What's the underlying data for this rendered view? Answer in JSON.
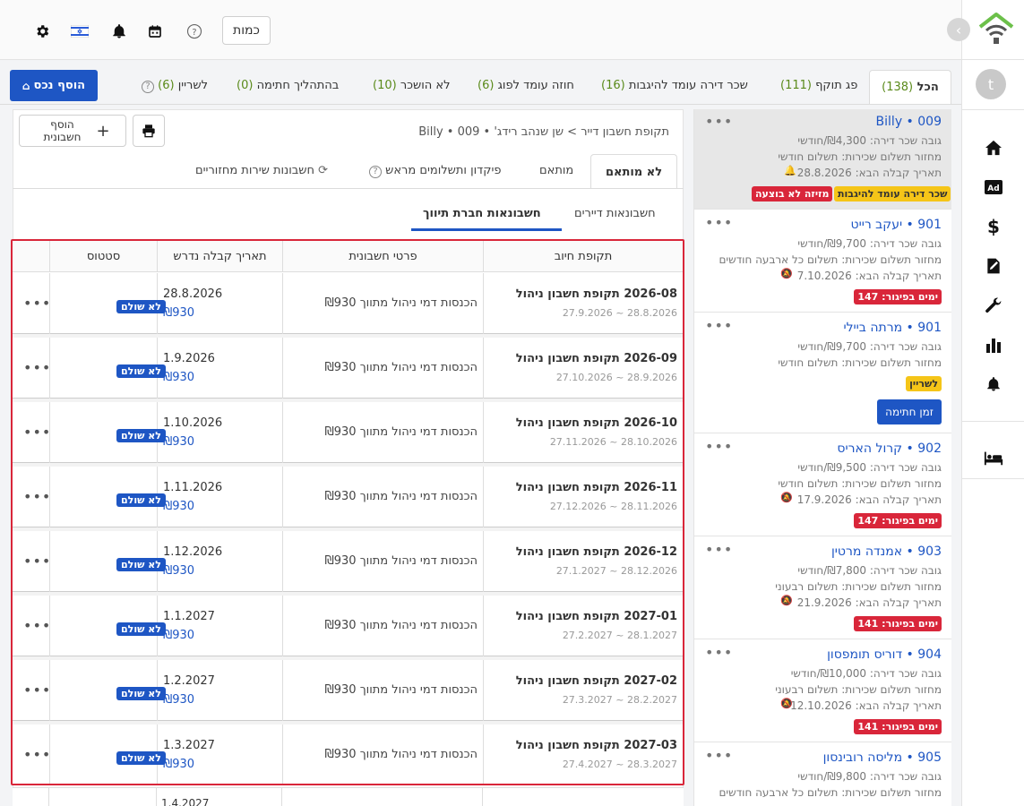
{
  "topbar": {
    "currency_label": "כמות",
    "icons": [
      "gear-icon",
      "flag-israel-icon",
      "bell-icon",
      "calendar-icon",
      "help-icon"
    ]
  },
  "sidebar": {
    "avatar_letter": "t",
    "nav": [
      "home-icon",
      "ad-icon",
      "dollar-icon",
      "contract-edit-icon",
      "wrench-icon",
      "bar-chart-icon",
      "bell-icon",
      "bed-icon"
    ]
  },
  "tabs": {
    "add_property": "הוסף נכס",
    "items": [
      {
        "label": "הכל",
        "count": "(138)"
      },
      {
        "label": "פג תוקף",
        "count": "(111)"
      },
      {
        "label": "שכר דירה עומד להיגבות",
        "count": "(16)"
      },
      {
        "label": "חוזה עומד לפוג",
        "count": "(6)"
      },
      {
        "label": "לא הושכר",
        "count": "(10)"
      },
      {
        "label": "בהתהליך חתימה",
        "count": "(0)"
      },
      {
        "label": "לשריין",
        "count": "(6)"
      }
    ]
  },
  "units": [
    {
      "title": "Billy • 009",
      "rent": "גובה שכר דירה: ₪4,300/חודשי",
      "cycle": "מחזור תשלום שכירות: תשלום חודשי",
      "next": "תאריך קבלה הבא: 28.8.2026",
      "badges": [
        "מזיזה לא בוצעה",
        "שכר דירה עומד להיגבות"
      ]
    },
    {
      "title": "901 • יעקב רייט",
      "rent": "גובה שכר דירה: ₪9,700/חודשי",
      "cycle": "מחזור תשלום שכירות: תשלום כל ארבעה חודשים",
      "next": "תאריך קבלה הבא: 7.10.2026",
      "badges": [
        "ימים בפיגור: 147"
      ]
    },
    {
      "title": "901 • מרתה ביילי",
      "rent": "גובה שכר דירה: ₪9,700/חודשי",
      "cycle": "מחזור תשלום שכירות: תשלום חודשי",
      "next": "",
      "badges": [
        "לשריין"
      ],
      "button": "זמן חתימה"
    },
    {
      "title": "902 • קרול האריס",
      "rent": "גובה שכר דירה: ₪9,500/חודשי",
      "cycle": "מחזור תשלום שכירות: תשלום חודשי",
      "next": "תאריך קבלה הבא: 17.9.2026",
      "badges": [
        "ימים בפיגור: 147"
      ]
    },
    {
      "title": "903 • אמנדה מרטין",
      "rent": "גובה שכר דירה: ₪7,800/חודשי",
      "cycle": "מחזור תשלום שכירות: תשלום רבעוני",
      "next": "תאריך קבלה הבא: 21.9.2026",
      "badges": [
        "ימים בפיגור: 141"
      ]
    },
    {
      "title": "904 • דוריס תומפסון",
      "rent": "גובה שכר דירה: ₪10,000/חודשי",
      "cycle": "מחזור תשלום שכירות: תשלום רבעוני",
      "next": "תאריך קבלה הבא: 12.10.2026",
      "badges": [
        "ימים בפיגור: 141"
      ]
    },
    {
      "title": "905 • מליסה רובינסון",
      "rent": "גובה שכר דירה: ₪9,800/חודשי",
      "cycle": "מחזור תשלום שכירות: תשלום כל ארבעה חודשים",
      "next": "",
      "badges": []
    }
  ],
  "main": {
    "add_invoice": "הוסף חשבונית",
    "breadcrumb": "תקופת חשבון דייר > שן שנהב רידג' • 009 • Billy",
    "subtabs": [
      "לא מותאם",
      "מותאם",
      "פיקדון ותשלומים מראש",
      "חשבונות שירות מחזוריים"
    ],
    "typetabs": [
      "חשבונאות דיירים",
      "חשבונאות חברת תיווך"
    ],
    "columns": {
      "period": "תקופת חיוב",
      "details": "פרטי חשבונית",
      "date": "תאריך קבלה נדרש",
      "status": "סטטוס"
    },
    "rows": [
      {
        "title": "2026-08 תקופת חשבון ניהול",
        "range": "28.8.2026 ~ 27.9.2026",
        "details": "הכנסות דמי ניהול מתווך ₪930",
        "date": "28.8.2026",
        "amount": "₪930",
        "status": "לא שולם"
      },
      {
        "title": "2026-09 תקופת חשבון ניהול",
        "range": "28.9.2026 ~ 27.10.2026",
        "details": "הכנסות דמי ניהול מתווך ₪930",
        "date": "1.9.2026",
        "amount": "₪930",
        "status": "לא שולם"
      },
      {
        "title": "2026-10 תקופת חשבון ניהול",
        "range": "28.10.2026 ~ 27.11.2026",
        "details": "הכנסות דמי ניהול מתווך ₪930",
        "date": "1.10.2026",
        "amount": "₪930",
        "status": "לא שולם"
      },
      {
        "title": "2026-11 תקופת חשבון ניהול",
        "range": "28.11.2026 ~ 27.12.2026",
        "details": "הכנסות דמי ניהול מתווך ₪930",
        "date": "1.11.2026",
        "amount": "₪930",
        "status": "לא שולם"
      },
      {
        "title": "2026-12 תקופת חשבון ניהול",
        "range": "28.12.2026 ~ 27.1.2027",
        "details": "הכנסות דמי ניהול מתווך ₪930",
        "date": "1.12.2026",
        "amount": "₪930",
        "status": "לא שולם"
      },
      {
        "title": "2027-01 תקופת חשבון ניהול",
        "range": "28.1.2027 ~ 27.2.2027",
        "details": "הכנסות דמי ניהול מתווך ₪930",
        "date": "1.1.2027",
        "amount": "₪930",
        "status": "לא שולם"
      },
      {
        "title": "2027-02 תקופת חשבון ניהול",
        "range": "28.2.2027 ~ 27.3.2027",
        "details": "הכנסות דמי ניהול מתווך ₪930",
        "date": "1.2.2027",
        "amount": "₪930",
        "status": "לא שולם"
      },
      {
        "title": "2027-03 תקופת חשבון ניהול",
        "range": "28.3.2027 ~ 27.4.2027",
        "details": "הכנסות דמי ניהול מתווך ₪930",
        "date": "1.3.2027",
        "amount": "₪930",
        "status": "לא שולם"
      }
    ],
    "next_row_date": "1.4.2027"
  }
}
